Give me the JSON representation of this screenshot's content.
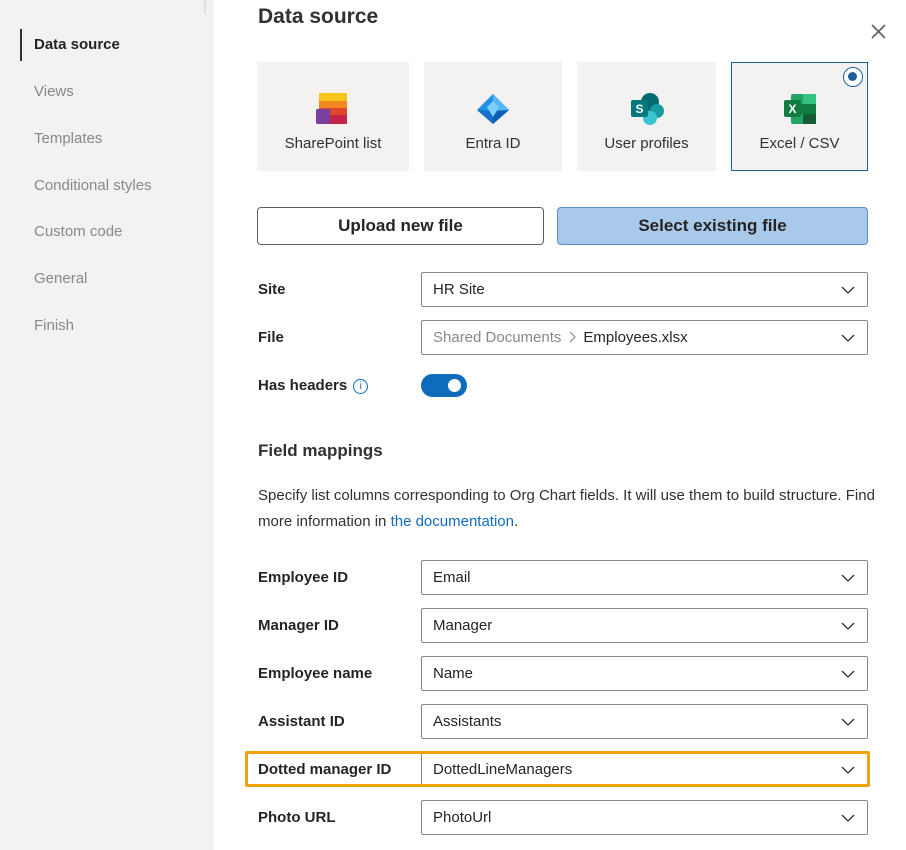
{
  "sidebar": {
    "items": [
      {
        "label": "Data source",
        "active": true
      },
      {
        "label": "Views"
      },
      {
        "label": "Templates"
      },
      {
        "label": "Conditional styles"
      },
      {
        "label": "Custom code"
      },
      {
        "label": "General"
      },
      {
        "label": "Finish"
      }
    ]
  },
  "page": {
    "title": "Data source"
  },
  "sources": [
    {
      "label": "SharePoint list",
      "icon": "sharepoint-list-icon"
    },
    {
      "label": "Entra ID",
      "icon": "entra-id-icon"
    },
    {
      "label": "User profiles",
      "icon": "sharepoint-icon"
    },
    {
      "label": "Excel / CSV",
      "icon": "excel-icon",
      "selected": true
    }
  ],
  "buttons": {
    "upload": "Upload new file",
    "select": "Select existing file"
  },
  "form": {
    "site": {
      "label": "Site",
      "value": "HR Site"
    },
    "file": {
      "label": "File",
      "folder": "Shared Documents",
      "name": "Employees.xlsx"
    },
    "has_headers": {
      "label": "Has headers",
      "info": "i",
      "on": true
    }
  },
  "field_mappings": {
    "title": "Field mappings",
    "description": "Specify list columns corresponding to Org Chart fields. It will use them to build structure. Find more information in ",
    "link": "the documentation",
    "period": ".",
    "rows": [
      {
        "label": "Employee ID",
        "value": "Email"
      },
      {
        "label": "Manager ID",
        "value": "Manager"
      },
      {
        "label": "Employee name",
        "value": "Name"
      },
      {
        "label": "Assistant ID",
        "value": "Assistants"
      },
      {
        "label": "Dotted manager ID",
        "value": "DottedLineManagers",
        "highlighted": true
      },
      {
        "label": "Photo URL",
        "value": "PhotoUrl"
      }
    ]
  },
  "colors": {
    "accent": "#0f6cbd",
    "highlight": "#f0a30a",
    "select_button": "#a9c9eb"
  }
}
